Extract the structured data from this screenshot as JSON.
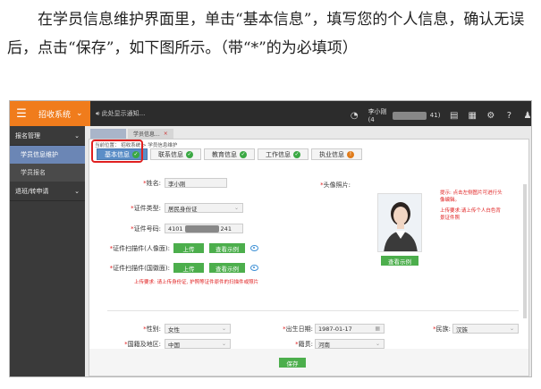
{
  "doc": {
    "paragraph": "在学员信息维护界面里，单击“基本信息”，填写您的个人信息，确认无误后，点击“保存”，如下图所示。（带“*”的为必填项）"
  },
  "topbar": {
    "menu_icon": "hamburger-icon",
    "system_label": "招收系统",
    "notice_text": "此处显示通知...",
    "user_prefix": "李小刚(4",
    "user_suffix": "41)"
  },
  "sidebar": {
    "groups": [
      {
        "label": "报名管理",
        "items": [
          "学员信息维护",
          "学员报名"
        ]
      },
      {
        "label": "退班/转申请",
        "items": []
      }
    ]
  },
  "page_tabs": {
    "tab2_label": "学员信息...",
    "close": "×"
  },
  "breadcrumb": {
    "prefix": "当前位置：",
    "p1": "招收系统",
    "sep": ">",
    "p2": "学员信息维护"
  },
  "form_tabs": [
    {
      "label": "基本信息",
      "status": "ok"
    },
    {
      "label": "联系信息",
      "status": "ok"
    },
    {
      "label": "教育信息",
      "status": "ok"
    },
    {
      "label": "工作信息",
      "status": "ok"
    },
    {
      "label": "执业信息",
      "status": "warn"
    }
  ],
  "form": {
    "name_label": "姓名:",
    "name_value": "李小刚",
    "photo_label": "头像照片:",
    "id_type_label": "证件类型:",
    "id_type_value": "居民身份证",
    "id_no_label": "证件号码:",
    "id_no_prefix": "4101",
    "id_no_suffix": "241",
    "scan_front_label": "证件扫描件(人像面):",
    "scan_back_label": "证件扫描件(国徽面):",
    "upload_label": "上传",
    "view_example_label": "查看示例",
    "scan_hint": "上传要求: 请上传身份证, 护照等证件原件的扫描件或照片",
    "photo_example_label": "查看示例",
    "photo_hint_title": "提示: 点击左侧图片可进行头像编辑。",
    "photo_hint_body": "上传要求:请上传个人白色背景证件照",
    "gender_label": "性别:",
    "gender_value": "女性",
    "birth_label": "出生日期:",
    "birth_value": "1987-01-17",
    "ethnic_label": "民族:",
    "ethnic_value": "汉族",
    "country_label": "国籍及地区:",
    "country_value": "中国",
    "native_label": "籍贯:",
    "native_value": "河南",
    "save_label": "保存"
  },
  "colors": {
    "accent_orange": "#f07c1c",
    "topbar_dark": "#2c2c2c",
    "sidebar_dark": "#3a3a3a",
    "active_tab_blue": "#5b8ec7",
    "success_green": "#4cae4c",
    "required_red": "#e02020"
  }
}
